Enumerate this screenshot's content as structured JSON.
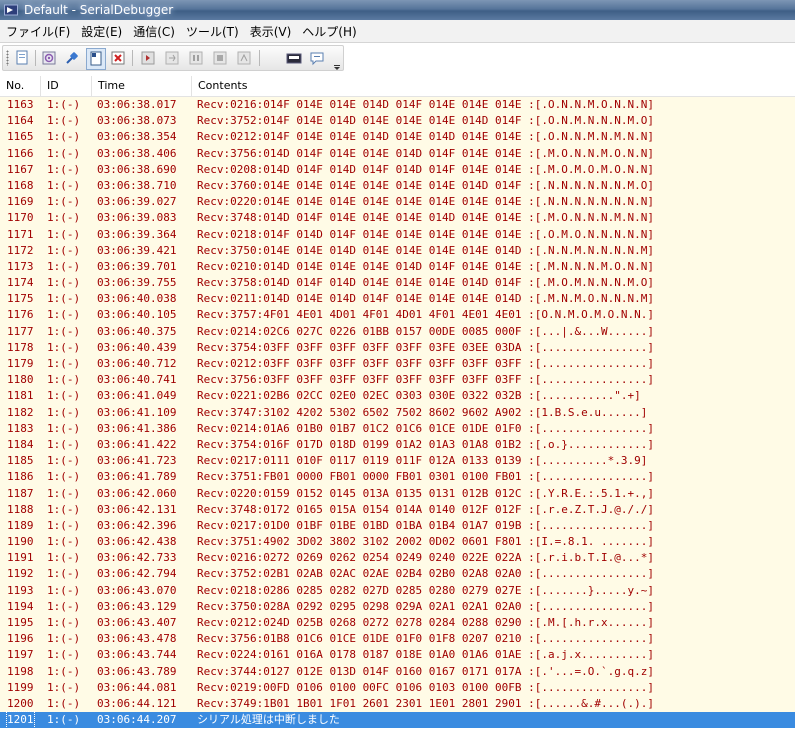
{
  "window": {
    "title": "Default - SerialDebugger"
  },
  "menu": [
    {
      "label": "ファイル(F)"
    },
    {
      "label": "設定(E)"
    },
    {
      "label": "通信(C)"
    },
    {
      "label": "ツール(T)"
    },
    {
      "label": "表示(V)"
    },
    {
      "label": "ヘルプ(H)"
    }
  ],
  "toolbar": {
    "buttons": [
      {
        "icon": "new-document-icon"
      },
      {
        "icon": "settings-gear-icon"
      },
      {
        "icon": "connect-plug-icon"
      },
      {
        "icon": "document-pressed-icon"
      },
      {
        "icon": "close-red-x-icon"
      },
      {
        "icon": "send-icon"
      },
      {
        "icon": "step-icon"
      },
      {
        "icon": "pause-icon"
      },
      {
        "icon": "stop-icon"
      },
      {
        "icon": "record-icon"
      },
      {
        "icon": "capture-icon"
      },
      {
        "icon": "message-icon"
      }
    ]
  },
  "columns": [
    "No.",
    "ID",
    "Time",
    "Contents"
  ],
  "rows": [
    {
      "no": "1163",
      "id": "1:(-)",
      "time": "03:06:38.017",
      "contents": "Recv:0216:014F 014E 014E 014D 014F 014E 014E 014E :[.O.N.N.M.O.N.N.N]"
    },
    {
      "no": "1164",
      "id": "1:(-)",
      "time": "03:06:38.073",
      "contents": "Recv:3752:014F 014E 014D 014E 014E 014E 014D 014F :[.O.N.M.N.N.N.M.O]"
    },
    {
      "no": "1165",
      "id": "1:(-)",
      "time": "03:06:38.354",
      "contents": "Recv:0212:014F 014E 014E 014D 014E 014D 014E 014E :[.O.N.N.M.N.M.N.N]"
    },
    {
      "no": "1166",
      "id": "1:(-)",
      "time": "03:06:38.406",
      "contents": "Recv:3756:014D 014F 014E 014E 014D 014F 014E 014E :[.M.O.N.N.M.O.N.N]"
    },
    {
      "no": "1167",
      "id": "1:(-)",
      "time": "03:06:38.690",
      "contents": "Recv:0208:014D 014F 014D 014F 014D 014F 014E 014E :[.M.O.M.O.M.O.N.N]"
    },
    {
      "no": "1168",
      "id": "1:(-)",
      "time": "03:06:38.710",
      "contents": "Recv:3760:014E 014E 014E 014E 014E 014E 014D 014F :[.N.N.N.N.N.N.M.O]"
    },
    {
      "no": "1169",
      "id": "1:(-)",
      "time": "03:06:39.027",
      "contents": "Recv:0220:014E 014E 014E 014E 014E 014E 014E 014E :[.N.N.N.N.N.N.N.N]"
    },
    {
      "no": "1170",
      "id": "1:(-)",
      "time": "03:06:39.083",
      "contents": "Recv:3748:014D 014F 014E 014E 014E 014D 014E 014E :[.M.O.N.N.N.M.N.N]"
    },
    {
      "no": "1171",
      "id": "1:(-)",
      "time": "03:06:39.364",
      "contents": "Recv:0218:014F 014D 014F 014E 014E 014E 014E 014E :[.O.M.O.N.N.N.N.N]"
    },
    {
      "no": "1172",
      "id": "1:(-)",
      "time": "03:06:39.421",
      "contents": "Recv:3750:014E 014E 014D 014E 014E 014E 014E 014D :[.N.N.M.N.N.N.N.M]"
    },
    {
      "no": "1173",
      "id": "1:(-)",
      "time": "03:06:39.701",
      "contents": "Recv:0210:014D 014E 014E 014E 014D 014F 014E 014E :[.M.N.N.N.M.O.N.N]"
    },
    {
      "no": "1174",
      "id": "1:(-)",
      "time": "03:06:39.755",
      "contents": "Recv:3758:014D 014F 014D 014E 014E 014E 014D 014F :[.M.O.M.N.N.N.M.O]"
    },
    {
      "no": "1175",
      "id": "1:(-)",
      "time": "03:06:40.038",
      "contents": "Recv:0211:014D 014E 014D 014F 014E 014E 014E 014D :[.M.N.M.O.N.N.N.M]"
    },
    {
      "no": "1176",
      "id": "1:(-)",
      "time": "03:06:40.105",
      "contents": "Recv:3757:4F01 4E01 4D01 4F01 4D01 4F01 4E01 4E01 :[O.N.M.O.M.O.N.N.]"
    },
    {
      "no": "1177",
      "id": "1:(-)",
      "time": "03:06:40.375",
      "contents": "Recv:0214:02C6 027C 0226 01BB 0157 00DE 0085 000F :[...|.&...W......]"
    },
    {
      "no": "1178",
      "id": "1:(-)",
      "time": "03:06:40.439",
      "contents": "Recv:3754:03FF 03FF 03FF 03FF 03FF 03FE 03EE 03DA :[................]"
    },
    {
      "no": "1179",
      "id": "1:(-)",
      "time": "03:06:40.712",
      "contents": "Recv:0212:03FF 03FF 03FF 03FF 03FF 03FF 03FF 03FF :[................]"
    },
    {
      "no": "1180",
      "id": "1:(-)",
      "time": "03:06:40.741",
      "contents": "Recv:3756:03FF 03FF 03FF 03FF 03FF 03FF 03FF 03FF :[................]"
    },
    {
      "no": "1181",
      "id": "1:(-)",
      "time": "03:06:41.049",
      "contents": "Recv:0221:02B6 02CC 02E0 02EC 0303 030E 0322 032B :[...........\".+]"
    },
    {
      "no": "1182",
      "id": "1:(-)",
      "time": "03:06:41.109",
      "contents": "Recv:3747:3102 4202 5302 6502 7502 8602 9602 A902 :[1.B.S.e.u......]"
    },
    {
      "no": "1183",
      "id": "1:(-)",
      "time": "03:06:41.386",
      "contents": "Recv:0214:01A6 01B0 01B7 01C2 01C6 01CE 01DE 01F0 :[................]"
    },
    {
      "no": "1184",
      "id": "1:(-)",
      "time": "03:06:41.422",
      "contents": "Recv:3754:016F 017D 018D 0199 01A2 01A3 01A8 01B2 :[.o.}............]"
    },
    {
      "no": "1185",
      "id": "1:(-)",
      "time": "03:06:41.723",
      "contents": "Recv:0217:0111 010F 0117 0119 011F 012A 0133 0139 :[..........*.3.9]"
    },
    {
      "no": "1186",
      "id": "1:(-)",
      "time": "03:06:41.789",
      "contents": "Recv:3751:FB01 0000 FB01 0000 FB01 0301 0100 FB01 :[................]"
    },
    {
      "no": "1187",
      "id": "1:(-)",
      "time": "03:06:42.060",
      "contents": "Recv:0220:0159 0152 0145 013A 0135 0131 012B 012C :[.Y.R.E.:.5.1.+.,]"
    },
    {
      "no": "1188",
      "id": "1:(-)",
      "time": "03:06:42.131",
      "contents": "Recv:3748:0172 0165 015A 0154 014A 0140 012F 012F :[.r.e.Z.T.J.@././]"
    },
    {
      "no": "1189",
      "id": "1:(-)",
      "time": "03:06:42.396",
      "contents": "Recv:0217:01D0 01BF 01BE 01BD 01BA 01B4 01A7 019B :[................]"
    },
    {
      "no": "1190",
      "id": "1:(-)",
      "time": "03:06:42.438",
      "contents": "Recv:3751:4902 3D02 3802 3102 2002 0D02 0601 F801 :[I.=.8.1. .......]"
    },
    {
      "no": "1191",
      "id": "1:(-)",
      "time": "03:06:42.733",
      "contents": "Recv:0216:0272 0269 0262 0254 0249 0240 022E 022A :[.r.i.b.T.I.@...*]"
    },
    {
      "no": "1192",
      "id": "1:(-)",
      "time": "03:06:42.794",
      "contents": "Recv:3752:02B1 02AB 02AC 02AE 02B4 02B0 02A8 02A0 :[................]"
    },
    {
      "no": "1193",
      "id": "1:(-)",
      "time": "03:06:43.070",
      "contents": "Recv:0218:0286 0285 0282 027D 0285 0280 0279 027E :[.......}.....y.~]"
    },
    {
      "no": "1194",
      "id": "1:(-)",
      "time": "03:06:43.129",
      "contents": "Recv:3750:028A 0292 0295 0298 029A 02A1 02A1 02A0 :[................]"
    },
    {
      "no": "1195",
      "id": "1:(-)",
      "time": "03:06:43.407",
      "contents": "Recv:0212:024D 025B 0268 0272 0278 0284 0288 0290 :[.M.[.h.r.x......]"
    },
    {
      "no": "1196",
      "id": "1:(-)",
      "time": "03:06:43.478",
      "contents": "Recv:3756:01B8 01C6 01CE 01DE 01F0 01F8 0207 0210 :[................]"
    },
    {
      "no": "1197",
      "id": "1:(-)",
      "time": "03:06:43.744",
      "contents": "Recv:0224:0161 016A 0178 0187 018E 01A0 01A6 01AE :[.a.j.x..........]"
    },
    {
      "no": "1198",
      "id": "1:(-)",
      "time": "03:06:43.789",
      "contents": "Recv:3744:0127 012E 013D 014F 0160 0167 0171 017A :[.'...=.O.`.g.q.z]"
    },
    {
      "no": "1199",
      "id": "1:(-)",
      "time": "03:06:44.081",
      "contents": "Recv:0219:00FD 0106 0100 00FC 0106 0103 0100 00FB :[................]"
    },
    {
      "no": "1200",
      "id": "1:(-)",
      "time": "03:06:44.121",
      "contents": "Recv:3749:1B01 1B01 1F01 2601 2301 1E01 2801 2901 :[......&.#...(.).]"
    },
    {
      "no": "1201",
      "id": "1:(-)",
      "time": "03:06:44.207",
      "contents": "シリアル処理は中断しました",
      "selected": true
    }
  ],
  "colors": {
    "row_background": "#fffbe6",
    "row_text": "#a00000",
    "selection": "#3a8be0"
  }
}
